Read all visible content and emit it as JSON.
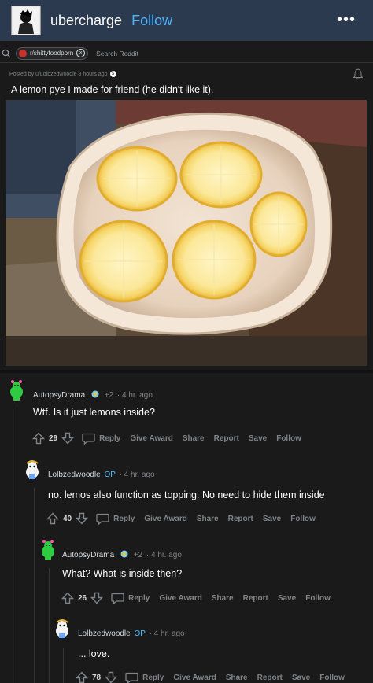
{
  "header": {
    "username": "ubercharge",
    "follow_label": "Follow",
    "more_label": "•••"
  },
  "search": {
    "subreddit": "r/shittyfoodporn",
    "placeholder": "Search Reddit",
    "chip_close": "×"
  },
  "post": {
    "meta": "Posted by u/Lolbzedwoodle 8 hours ago",
    "meta_coin": "$",
    "title": "A lemon pye I made for friend (he didn't like it)."
  },
  "comments": [
    {
      "author": "AutopsyDrama",
      "score_delta": "+2",
      "time": "· 4 hr. ago",
      "body": "Wtf. Is it just lemons inside?",
      "votes": "29",
      "actions": [
        "Reply",
        "Give Award",
        "Share",
        "Report",
        "Save",
        "Follow"
      ]
    },
    {
      "author": "Lolbzedwoodle",
      "op_badge": "OP",
      "time": "· 4 hr. ago",
      "body": "no. lemos also function as topping. No need to hide them inside",
      "votes": "40",
      "actions": [
        "Reply",
        "Give Award",
        "Share",
        "Report",
        "Save",
        "Follow"
      ]
    },
    {
      "author": "AutopsyDrama",
      "score_delta": "+2",
      "time": "· 4 hr. ago",
      "body": "What? What is inside then?",
      "votes": "26",
      "actions": [
        "Reply",
        "Give Award",
        "Share",
        "Report",
        "Save",
        "Follow"
      ]
    },
    {
      "author": "Lolbzedwoodle",
      "op_badge": "OP",
      "time": "· 4 hr. ago",
      "body": "... love.",
      "votes": "78",
      "actions": [
        "Reply",
        "Give Award",
        "Share",
        "Report",
        "Save",
        "Follow"
      ]
    }
  ],
  "colors": {
    "background": "#1a1a1b",
    "header_bg": "#2c3a4f",
    "follow_blue": "#4fb3ff",
    "op_blue": "#4fbcff",
    "muted_text": "#818384"
  }
}
